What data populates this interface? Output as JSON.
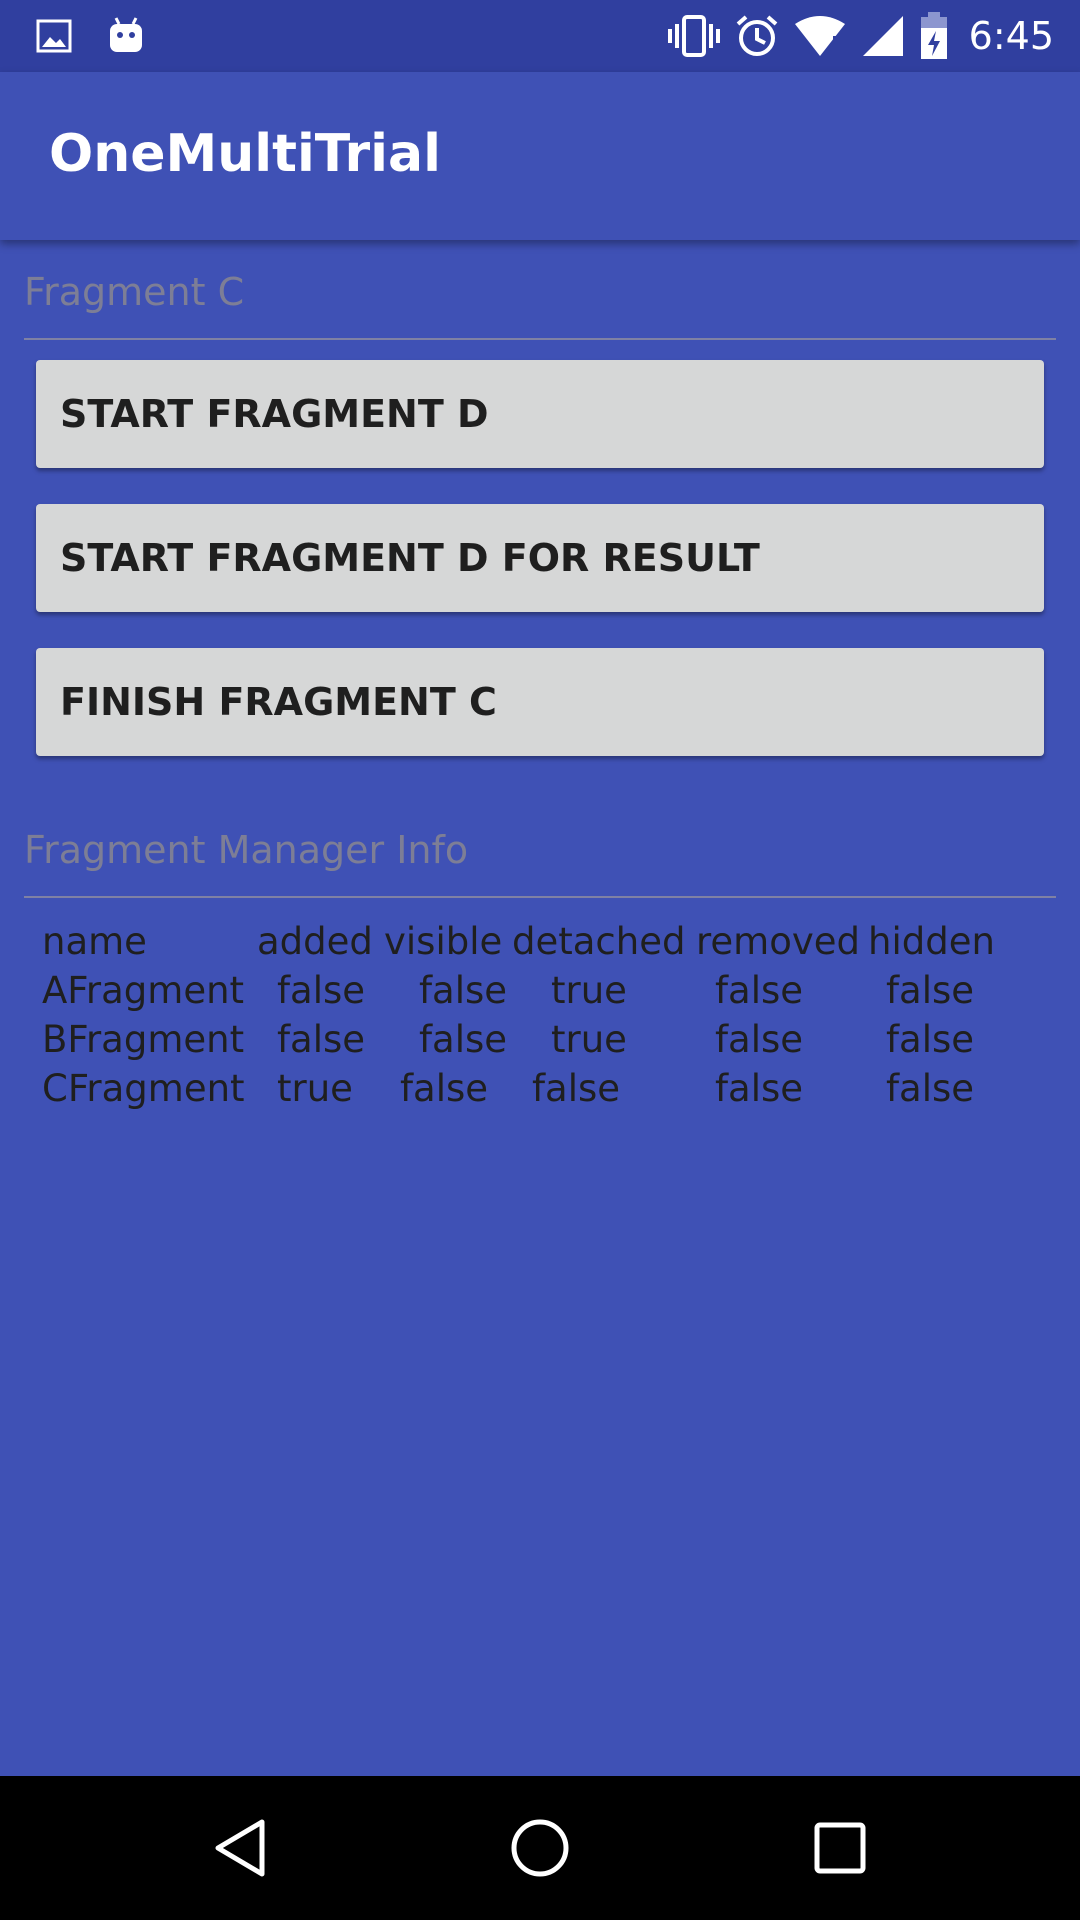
{
  "status_bar": {
    "time": "6:45",
    "left_icons": [
      "image-icon",
      "android-icon"
    ],
    "right_icons": [
      "vibrate-icon",
      "alarm-icon",
      "wifi-icon",
      "signal-icon",
      "battery-charging-icon"
    ]
  },
  "app_bar": {
    "title": "OneMultiTrial"
  },
  "fragment_section": {
    "label": "Fragment C",
    "buttons": [
      {
        "label": "START FRAGMENT D"
      },
      {
        "label": "START FRAGMENT D FOR RESULT"
      },
      {
        "label": "FINISH FRAGMENT C"
      }
    ]
  },
  "info_section": {
    "label": "Fragment Manager Info",
    "columns": [
      "name",
      "added",
      "visible",
      "detached",
      "removed",
      "hidden"
    ],
    "rows": [
      [
        "AFragment",
        "false",
        "false",
        "true",
        "false",
        "false"
      ],
      [
        "BFragment",
        "false",
        "false",
        "true",
        "false",
        "false"
      ],
      [
        "CFragment",
        "true",
        "false",
        "false",
        "false",
        "false"
      ]
    ]
  },
  "nav_bar": {
    "icons": [
      "back-icon",
      "home-icon",
      "recents-icon"
    ]
  },
  "colors": {
    "primary": "#3f51b5",
    "primary_dark": "#303f9f",
    "button_bg": "#d6d7d7",
    "label_gray": "#7d7e96"
  }
}
